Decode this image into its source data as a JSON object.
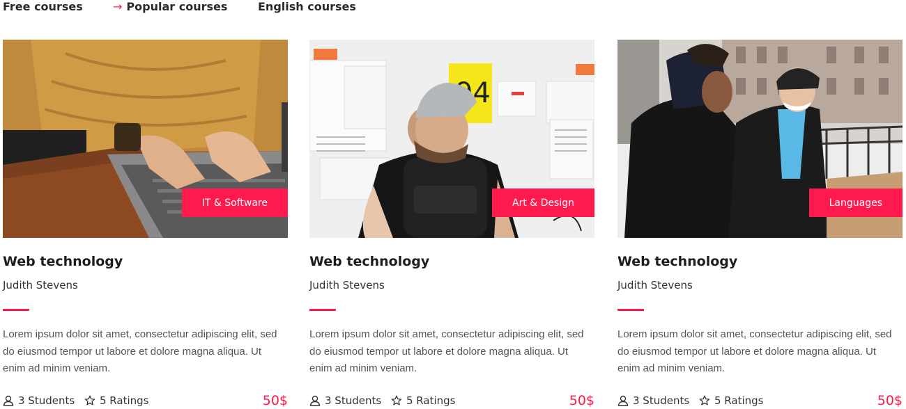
{
  "tabs": [
    {
      "label": "Free courses",
      "active": false
    },
    {
      "label": "Popular courses",
      "active": true,
      "arrow": "→"
    },
    {
      "label": "English courses",
      "active": false
    }
  ],
  "accent_color": "#ff1a4e",
  "courses": [
    {
      "category": "IT & Software",
      "title": "Web technology",
      "author": "Judith Stevens",
      "description": "Lorem ipsum dolor sit amet, consectetur adipiscing elit, sed do eiusmod tempor ut labore et dolore magna aliqua. Ut enim ad minim veniam.",
      "students": "3 Students",
      "ratings": "5 Ratings",
      "price": "50$"
    },
    {
      "category": "Art & Design",
      "title": "Web technology",
      "author": "Judith Stevens",
      "description": "Lorem ipsum dolor sit amet, consectetur adipiscing elit, sed do eiusmod tempor ut labore et dolore magna aliqua. Ut enim ad minim veniam.",
      "students": "3 Students",
      "ratings": "5 Ratings",
      "price": "50$",
      "poster_text": "94"
    },
    {
      "category": "Languages",
      "title": "Web technology",
      "author": "Judith Stevens",
      "description": "Lorem ipsum dolor sit amet, consectetur adipiscing elit, sed do eiusmod tempor ut labore et dolore magna aliqua. Ut enim ad minim veniam.",
      "students": "3 Students",
      "ratings": "5 Ratings",
      "price": "50$"
    }
  ],
  "icons": {
    "students": "user-icon",
    "ratings": "star-icon"
  }
}
